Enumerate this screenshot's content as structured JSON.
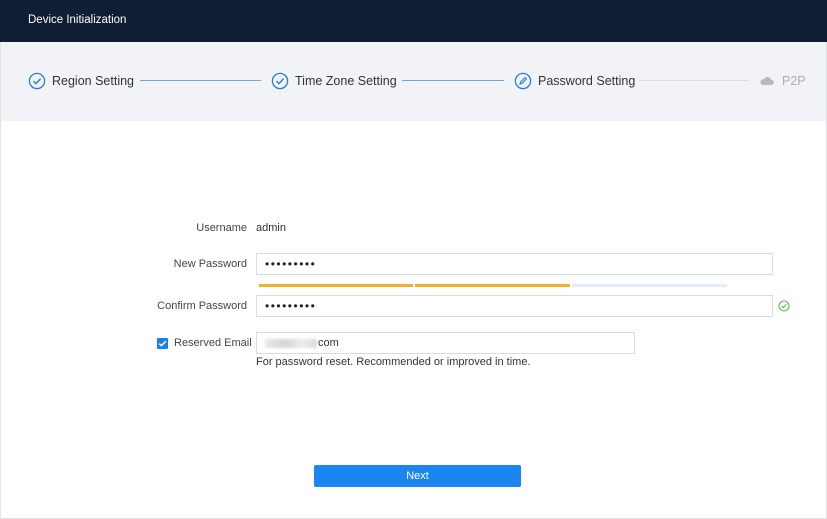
{
  "window": {
    "title": "Device Initialization"
  },
  "steps": [
    {
      "label": "Region Setting",
      "state": "done"
    },
    {
      "label": "Time Zone Setting",
      "state": "done"
    },
    {
      "label": "Password Setting",
      "state": "current"
    },
    {
      "label": "P2P",
      "state": "pending"
    }
  ],
  "form": {
    "username_label": "Username",
    "username_value": "admin",
    "new_password_label": "New Password",
    "new_password_value": "•••••••••",
    "password_strength": {
      "filled_segments": 2,
      "total_segments": 3
    },
    "confirm_password_label": "Confirm Password",
    "confirm_password_value": "•••••••••",
    "reserved_email_label": "Reserved Email",
    "reserved_email_checked": true,
    "reserved_email_value_visible": "com",
    "hint": "For password reset. Recommended or improved in time."
  },
  "actions": {
    "next_label": "Next"
  },
  "colors": {
    "titlebar": "#0f1e33",
    "accent": "#1b85f1",
    "step_done": "#2a7fd4",
    "strength_fill": "#f0b02a",
    "ok": "#5cb85c",
    "disabled": "#a9aeb6"
  }
}
